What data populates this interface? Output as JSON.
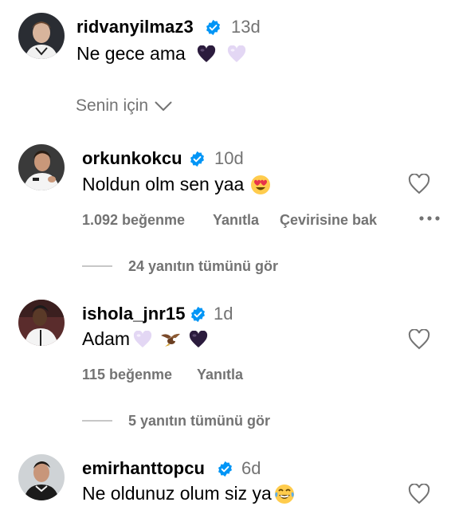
{
  "section_label": "Senin için",
  "comments": [
    {
      "username": "ridvanyilmaz3",
      "time": "13d",
      "text": "Ne gece ama",
      "emojis": [
        "black-heart",
        "light-purple-heart"
      ]
    },
    {
      "username": "orkunkokcu",
      "time": "10d",
      "text": "Noldun olm sen yaa",
      "emojis": [
        "heart-eyes"
      ],
      "likes": "1.092 beğenme",
      "reply_label": "Yanıtla",
      "translate_label": "Çevirisine bak",
      "view_replies": "24 yanıtın tümünü gör"
    },
    {
      "username": "ishola_jnr15",
      "time": "1d",
      "text": "Adam",
      "emojis": [
        "light-purple-heart",
        "eagle",
        "black-heart"
      ],
      "likes": "115 beğenme",
      "reply_label": "Yanıtla",
      "view_replies": "5 yanıtın tümünü gör"
    },
    {
      "username": "emirhanttopcu",
      "time": "6d",
      "text": "Ne oldunuz olum siz ya",
      "emojis": [
        "joy"
      ]
    }
  ],
  "colors": {
    "verified": "#0095f6",
    "muted": "#737373",
    "divider": "#c7c7c7"
  }
}
